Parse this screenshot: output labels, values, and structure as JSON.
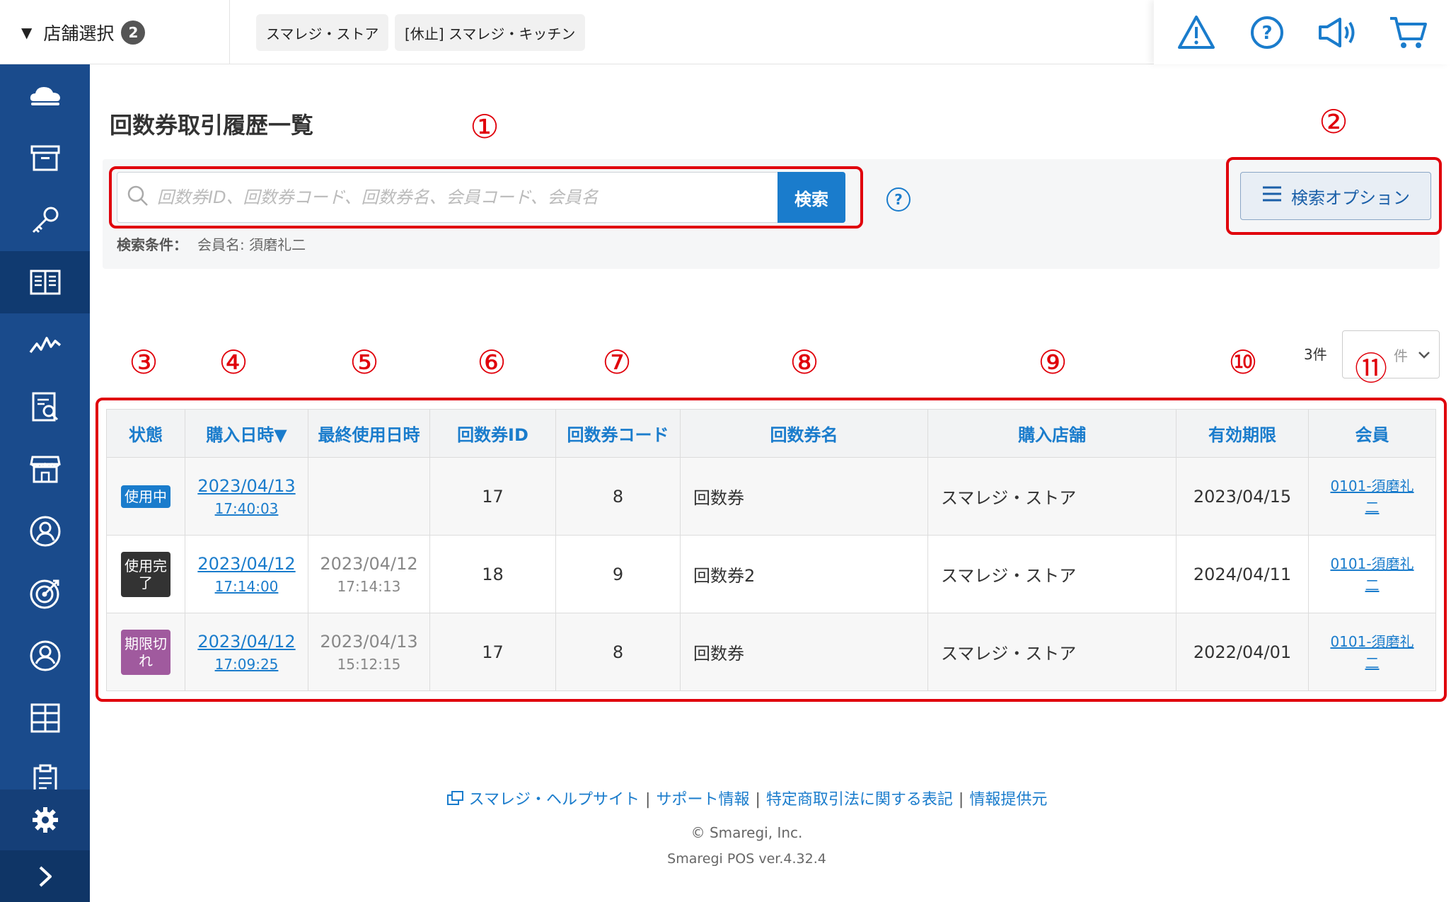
{
  "topbar": {
    "store_select_label": "店舗選択",
    "store_count": "2",
    "stores": [
      "スマレジ・ストア",
      "[休止] スマレジ・キッチン"
    ],
    "icons": [
      "alert-icon",
      "help-icon",
      "megaphone-icon",
      "cart-icon"
    ]
  },
  "sidebar": {
    "items": [
      "cloud-icon",
      "box-icon",
      "key-icon",
      "book-icon",
      "chart-icon",
      "report-icon",
      "store-icon",
      "customer-icon",
      "target-icon",
      "member-icon",
      "grid-icon",
      "clipboard-icon"
    ],
    "active_index": 3,
    "settings": "gear-icon",
    "expand": "chevron-right-icon"
  },
  "page": {
    "title": "回数券取引履歴一覧"
  },
  "search": {
    "placeholder": "回数券ID、回数券コード、回数券名、会員コード、会員名",
    "button": "検索",
    "help": "?",
    "condition_label": "検索条件：",
    "condition_value": "会員名: 須磨礼二",
    "option_button": "検索オプション"
  },
  "annotations": [
    "①",
    "②",
    "③",
    "④",
    "⑤",
    "⑥",
    "⑦",
    "⑧",
    "⑨",
    "⑩",
    "⑪"
  ],
  "pagination": {
    "count": "3件",
    "per_page": "件"
  },
  "table": {
    "headers": [
      "状態",
      "購入日時▼",
      "最終使用日時",
      "回数券ID",
      "回数券コード",
      "回数券名",
      "購入店舗",
      "有効期限",
      "会員"
    ],
    "rows": [
      {
        "status": "使用中",
        "purchase_date": "2023/04/13",
        "purchase_time": "17:40:03",
        "last_used_date": "",
        "last_used_time": "",
        "id": "17",
        "code": "8",
        "name": "回数券",
        "store": "スマレジ・ストア",
        "expiry": "2023/04/15",
        "member": "0101-須磨礼二"
      },
      {
        "status": "使用完了",
        "purchase_date": "2023/04/12",
        "purchase_time": "17:14:00",
        "last_used_date": "2023/04/12",
        "last_used_time": "17:14:13",
        "id": "18",
        "code": "9",
        "name": "回数券2",
        "store": "スマレジ・ストア",
        "expiry": "2024/04/11",
        "member": "0101-須磨礼二"
      },
      {
        "status": "期限切れ",
        "purchase_date": "2023/04/12",
        "purchase_time": "17:09:25",
        "last_used_date": "2023/04/13",
        "last_used_time": "15:12:15",
        "id": "17",
        "code": "8",
        "name": "回数券",
        "store": "スマレジ・ストア",
        "expiry": "2022/04/01",
        "member": "0101-須磨礼二"
      }
    ]
  },
  "footer": {
    "links": [
      "スマレジ・ヘルプサイト",
      "サポート情報",
      "特定商取引法に関する表記",
      "情報提供元"
    ],
    "copyright": "© Smaregi, Inc.",
    "version": "Smaregi POS ver.4.32.4"
  },
  "colors": {
    "sidebar": "#1a4b8c",
    "accent": "#1a7ccc",
    "annotation_red": "#e0000b",
    "status_using": "#1a7ccc",
    "status_done": "#333333",
    "status_expired": "#a05a9e"
  }
}
